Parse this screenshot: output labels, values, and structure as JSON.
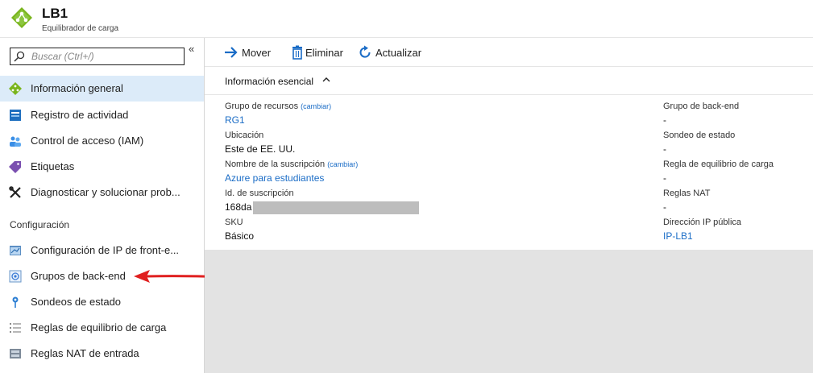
{
  "header": {
    "title": "LB1",
    "subtitle": "Equilibrador de carga",
    "logo_icon": "load-balancer-icon"
  },
  "sidebar": {
    "search_placeholder": "Buscar (Ctrl+/)",
    "collapse_label": "«",
    "items": [
      {
        "label": "Información general",
        "icon": "overview-icon",
        "active": true
      },
      {
        "label": "Registro de actividad",
        "icon": "activity-log-icon"
      },
      {
        "label": "Control de acceso (IAM)",
        "icon": "iam-icon"
      },
      {
        "label": "Etiquetas",
        "icon": "tag-icon"
      },
      {
        "label": "Diagnosticar y solucionar prob...",
        "icon": "wrench-icon"
      }
    ],
    "section_label": "Configuración",
    "config_items": [
      {
        "label": "Configuración de IP de front-e...",
        "icon": "frontend-ip-icon"
      },
      {
        "label": "Grupos de back-end",
        "icon": "backend-pool-icon"
      },
      {
        "label": "Sondeos de estado",
        "icon": "health-probe-icon"
      },
      {
        "label": "Reglas de equilibrio de carga",
        "icon": "rules-icon"
      },
      {
        "label": "Reglas NAT de entrada",
        "icon": "nat-rules-icon"
      }
    ]
  },
  "toolbar": {
    "move_label": "Mover",
    "delete_label": "Eliminar",
    "refresh_label": "Actualizar"
  },
  "essentials": {
    "heading": "Información esencial",
    "change_label": "(cambiar)",
    "left": {
      "resource_group_label": "Grupo de recursos",
      "resource_group_value": "RG1",
      "location_label": "Ubicación",
      "location_value": "Este de EE. UU.",
      "subscription_name_label": "Nombre de la suscripción",
      "subscription_name_value": "Azure para estudiantes",
      "subscription_id_label": "Id. de suscripción",
      "subscription_id_value": "168da",
      "sku_label": "SKU",
      "sku_value": "Básico"
    },
    "right": {
      "backend_pool_label": "Grupo de back-end",
      "backend_pool_value": "-",
      "health_probe_label": "Sondeo de estado",
      "health_probe_value": "-",
      "lb_rule_label": "Regla de equilibrio de carga",
      "lb_rule_value": "-",
      "nat_rules_label": "Reglas NAT",
      "nat_rules_value": "-",
      "public_ip_label": "Dirección IP pública",
      "public_ip_value": "IP-LB1"
    }
  },
  "colors": {
    "accent": "#1a6cc6",
    "active_bg": "#dcebf9",
    "arrow": "#e02020"
  }
}
